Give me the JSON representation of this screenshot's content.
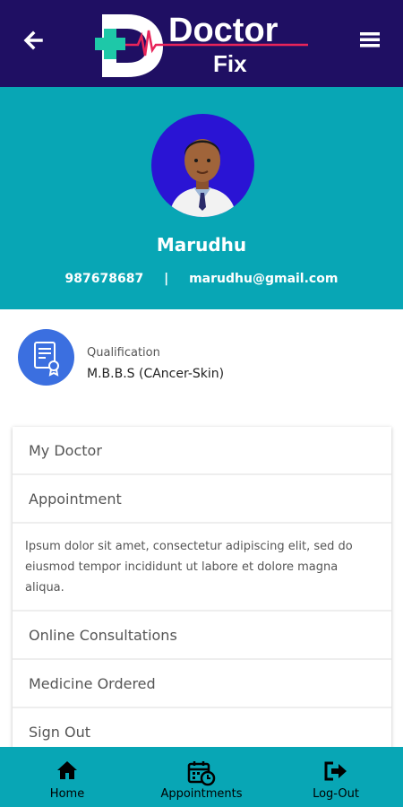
{
  "header": {
    "logo_title": "Doctor",
    "logo_subtitle": "Fix",
    "back_icon": "arrow-left-icon",
    "menu_icon": "hamburger-menu-icon"
  },
  "profile": {
    "name": "Marudhu",
    "phone": "987678687",
    "separator": "|",
    "email": "marudhu@gmail.com"
  },
  "qualification": {
    "label": "Qualification",
    "value": "M.B.B.S (CAncer-Skin)"
  },
  "menu": {
    "my_doctor": "My Doctor",
    "appointment": "Appointment",
    "description": "Ipsum dolor sit amet, consectetur adipiscing elit, sed do eiusmod tempor incididunt ut labore et dolore magna aliqua.",
    "online_consultations": "Online Consultations",
    "medicine_ordered": "Medicine Ordered",
    "sign_out": "Sign Out"
  },
  "bottom_nav": {
    "home": "Home",
    "appointments": "Appointments",
    "logout": "Log-Out"
  },
  "colors": {
    "header_bg": "#1f0f63",
    "profile_bg": "#08a6b5",
    "logo_cross": "#1ec8a8",
    "logo_line": "#e8245a"
  }
}
